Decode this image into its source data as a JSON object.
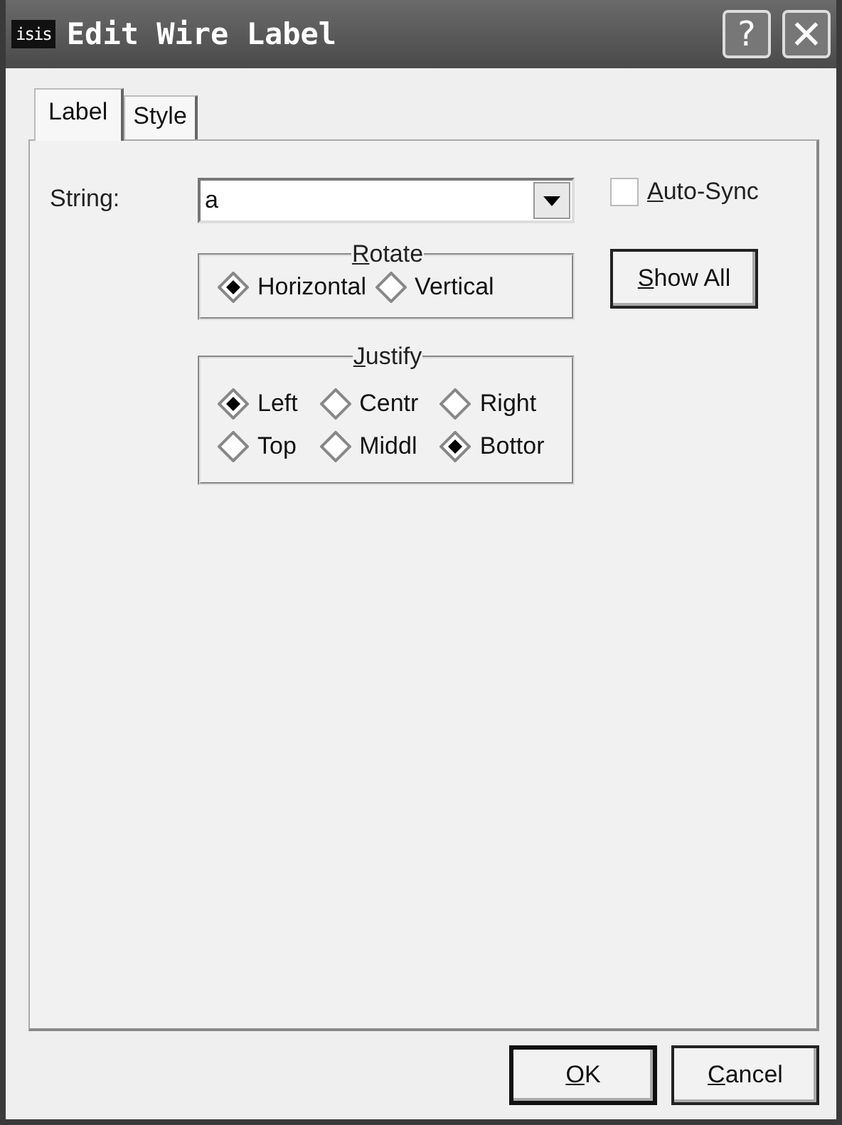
{
  "window": {
    "title": "Edit Wire Label",
    "app_badge": "isis"
  },
  "title_buttons": [
    {
      "kind": "help",
      "label": "?"
    },
    {
      "kind": "close",
      "label": "✕"
    }
  ],
  "tabs": [
    {
      "label": "Label",
      "selected": true
    },
    {
      "label": "Style",
      "selected": false
    }
  ],
  "string_field": {
    "label": "String:",
    "value": "a"
  },
  "auto_sync": {
    "label": "Auto-Sync",
    "checked": false,
    "mnemonic": true
  },
  "show_all_button": {
    "label": "Show All",
    "mnemonic": true
  },
  "rotate": {
    "title": "Rotate",
    "mnemonic": true,
    "options": [
      {
        "label": "Horizontal",
        "selected": true
      },
      {
        "label": "Vertical",
        "selected": false
      }
    ]
  },
  "justify": {
    "title": "Justify",
    "mnemonic": true,
    "options": [
      {
        "label": "Left",
        "selected": true
      },
      {
        "label": "Centr",
        "selected": false
      },
      {
        "label": "Right",
        "selected": false
      },
      {
        "label": "Top",
        "selected": false
      },
      {
        "label": "Middl",
        "selected": false
      },
      {
        "label": "Bottor",
        "selected": true
      }
    ]
  },
  "buttons": [
    {
      "label": "OK",
      "default": true,
      "mnemonic": true
    },
    {
      "label": "Cancel",
      "default": false,
      "mnemonic": true
    }
  ]
}
